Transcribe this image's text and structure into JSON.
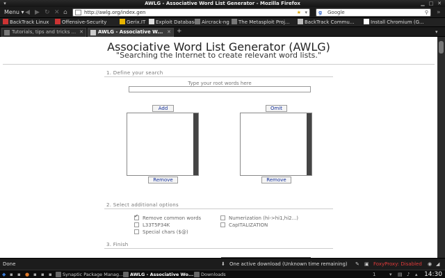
{
  "window": {
    "title": "AWLG - Associative Word List Generator - Mozilla Firefox"
  },
  "toolbar": {
    "menu_label": "Menu",
    "url": "http://awlg.org/index.gen",
    "search_engine": "Google"
  },
  "bookmarks": [
    {
      "label": "BackTrack Linux"
    },
    {
      "label": "Offensive-Security"
    },
    {
      "label": "Gerix.IT"
    },
    {
      "label": "Exploit Database"
    },
    {
      "label": "Aircrack-ng"
    },
    {
      "label": "The Metasploit Proj..."
    },
    {
      "label": "BackTrack Commu..."
    },
    {
      "label": "Install Chromium (G..."
    }
  ],
  "tabs": [
    {
      "label": "Tutorials, tips and tricks ...",
      "active": false
    },
    {
      "label": "AWLG - Associative W...",
      "active": true
    }
  ],
  "page": {
    "title": "Associative Word List Generator (AWLG)",
    "subtitle": "\"Searching the Internet to create relevant word lists.\"",
    "section1": "1. Define your search",
    "root_hint": "Type your root words here",
    "add_label": "Add",
    "omit_label": "Omit",
    "remove_label": "Remove",
    "section2": "2. Select additional options",
    "options": [
      {
        "label": "Remove common words",
        "checked": true
      },
      {
        "label": "Numerization (hi->hi1,hi2...)",
        "checked": false
      },
      {
        "label": "L33T5P34K",
        "checked": false
      },
      {
        "label": "CapITALIZATION",
        "checked": false
      },
      {
        "label": "Special chars ($@)",
        "checked": false
      }
    ],
    "section3": "3. Finish"
  },
  "statusbar": {
    "status": "Done",
    "downloads": "One active download (Unknown time remaining)",
    "foxyproxy": "FoxyProxy: Disabled"
  },
  "taskbar": {
    "items": [
      {
        "label": "Synaptic Package Manag...",
        "active": false
      },
      {
        "label": "AWLG - Associative Wo...",
        "active": true
      },
      {
        "label": "Downloads",
        "active": false
      }
    ],
    "workspace": "1",
    "clock": "14:30"
  },
  "colors": {
    "foxyproxy_disabled": "#e23b3b",
    "link_button_text": "#14309a"
  }
}
